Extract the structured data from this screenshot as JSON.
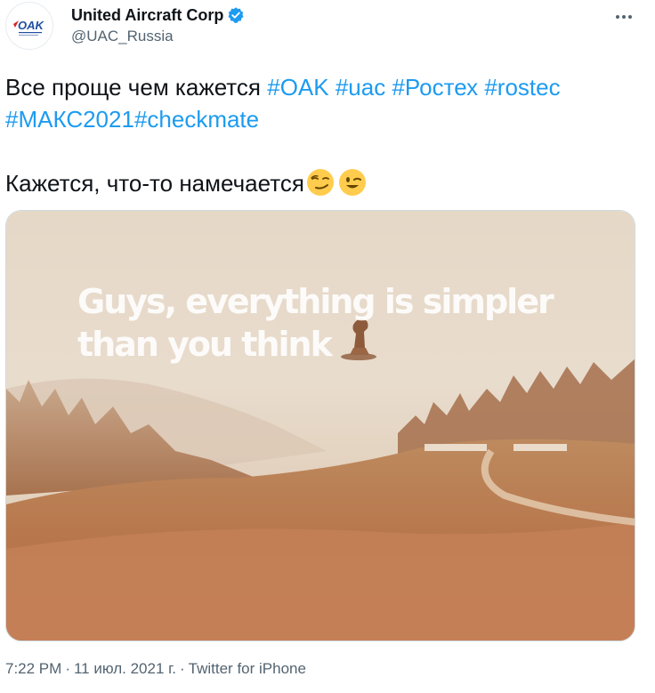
{
  "author": {
    "display_name": "United Aircraft Corp",
    "handle": "@UAC_Russia",
    "logo_text": "OAK"
  },
  "tweet": {
    "line1_text": "Все проще чем кажется ",
    "line1_hashtags": [
      "#OAK",
      "#uac",
      "#Ростех",
      "#rostec"
    ],
    "line2_hashtags": [
      "#МАКС2021",
      "#checkmate"
    ],
    "line3_text": "Кажется, что-то намечается",
    "emojis": [
      "smirking-face",
      "winking-face"
    ]
  },
  "media": {
    "caption_line1": "Guys, everything is simpler",
    "caption_line2": "than you think"
  },
  "meta": {
    "time": "7:22 PM",
    "date": "11 июл. 2021 г.",
    "source": "Twitter for iPhone",
    "separator": "·"
  },
  "colors": {
    "hashtag": "#1d9bf0",
    "verified": "#1d9bf0",
    "secondary_text": "#536471"
  }
}
